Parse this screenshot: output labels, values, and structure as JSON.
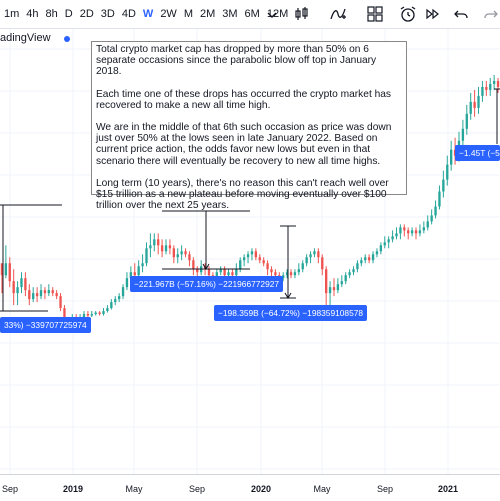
{
  "toolbar": {
    "timeframes": [
      "1m",
      "4h",
      "8h",
      "D",
      "2D",
      "3D",
      "4D",
      "W",
      "2W",
      "M",
      "2M",
      "3M",
      "6M",
      "12M"
    ],
    "active": "W",
    "icons": [
      "chevron-down-icon",
      "bar-style-icon",
      "indicators-icon",
      "layout-icon",
      "alert-icon",
      "replay-icon",
      "undo-icon",
      "redo-icon"
    ]
  },
  "watermark": "adingView",
  "note": {
    "p1": "Total crypto market cap has dropped by more than 50% on 6 separate occasions since the parabolic blow off top in January 2018.",
    "p2": "Each time one of these drops has occurred the crypto market has recovered to make a new all time high.",
    "p3": "We are in the middle of that 6th such occasion as price was down just over 50% at the lows seen in late January 2022. Based on current price action, the odds favor new lows but even in that scenario there will eventually be recovery to new all time highs.",
    "p4": "Long term (10 years), there's no reason this can't reach well over $15 trillion as a new plateau before moving eventually over $100 trillion over the next 25 years."
  },
  "measurements": {
    "m1": "33%) −339707725974",
    "m2": "−221.967B (−57.16%) −221966772927",
    "m3": "−198.359B (−64.72%) −198359108578",
    "m4": "−1.45T (−5"
  },
  "colors": {
    "up": "#26a69a",
    "down": "#ef5350",
    "accent": "#2962ff"
  },
  "chart_data": {
    "type": "candlestick",
    "x_ticks": [
      "Sep",
      "2019",
      "May",
      "Sep",
      "2020",
      "May",
      "Sep",
      "2021"
    ],
    "series_note": "Weekly total crypto market cap, values in chart price units (approximate)",
    "candles": [
      [
        0.3,
        0.26,
        0.2,
        0.29
      ],
      [
        0.26,
        0.3,
        0.25,
        0.36
      ],
      [
        0.3,
        0.24,
        0.22,
        0.32
      ],
      [
        0.24,
        0.2,
        0.16,
        0.28
      ],
      [
        0.2,
        0.22,
        0.16,
        0.24
      ],
      [
        0.22,
        0.25,
        0.2,
        0.27
      ],
      [
        0.25,
        0.21,
        0.19,
        0.27
      ],
      [
        0.21,
        0.18,
        0.16,
        0.23
      ],
      [
        0.18,
        0.2,
        0.17,
        0.22
      ],
      [
        0.2,
        0.19,
        0.17,
        0.22
      ],
      [
        0.19,
        0.21,
        0.18,
        0.23
      ],
      [
        0.21,
        0.2,
        0.18,
        0.22
      ],
      [
        0.2,
        0.21,
        0.19,
        0.23
      ],
      [
        0.21,
        0.2,
        0.19,
        0.22
      ],
      [
        0.2,
        0.19,
        0.18,
        0.21
      ],
      [
        0.19,
        0.15,
        0.14,
        0.2
      ],
      [
        0.15,
        0.11,
        0.1,
        0.16
      ],
      [
        0.11,
        0.1,
        0.09,
        0.12
      ],
      [
        0.1,
        0.12,
        0.09,
        0.13
      ],
      [
        0.12,
        0.11,
        0.1,
        0.13
      ],
      [
        0.11,
        0.12,
        0.1,
        0.13
      ],
      [
        0.12,
        0.13,
        0.11,
        0.14
      ],
      [
        0.13,
        0.125,
        0.12,
        0.14
      ],
      [
        0.125,
        0.13,
        0.12,
        0.14
      ],
      [
        0.13,
        0.135,
        0.125,
        0.14
      ],
      [
        0.135,
        0.13,
        0.125,
        0.14
      ],
      [
        0.13,
        0.14,
        0.125,
        0.15
      ],
      [
        0.14,
        0.15,
        0.135,
        0.16
      ],
      [
        0.15,
        0.17,
        0.145,
        0.18
      ],
      [
        0.17,
        0.18,
        0.16,
        0.19
      ],
      [
        0.18,
        0.19,
        0.17,
        0.2
      ],
      [
        0.19,
        0.22,
        0.18,
        0.23
      ],
      [
        0.22,
        0.25,
        0.21,
        0.27
      ],
      [
        0.25,
        0.27,
        0.24,
        0.29
      ],
      [
        0.27,
        0.26,
        0.25,
        0.3
      ],
      [
        0.26,
        0.29,
        0.25,
        0.31
      ],
      [
        0.29,
        0.3,
        0.27,
        0.33
      ],
      [
        0.3,
        0.35,
        0.29,
        0.37
      ],
      [
        0.35,
        0.36,
        0.32,
        0.4
      ],
      [
        0.36,
        0.38,
        0.34,
        0.4
      ],
      [
        0.38,
        0.36,
        0.33,
        0.4
      ],
      [
        0.36,
        0.34,
        0.32,
        0.38
      ],
      [
        0.34,
        0.36,
        0.33,
        0.38
      ],
      [
        0.36,
        0.35,
        0.33,
        0.38
      ],
      [
        0.35,
        0.32,
        0.3,
        0.36
      ],
      [
        0.32,
        0.33,
        0.3,
        0.35
      ],
      [
        0.33,
        0.34,
        0.31,
        0.36
      ],
      [
        0.34,
        0.33,
        0.32,
        0.35
      ],
      [
        0.33,
        0.31,
        0.29,
        0.34
      ],
      [
        0.31,
        0.28,
        0.26,
        0.32
      ],
      [
        0.28,
        0.27,
        0.25,
        0.29
      ],
      [
        0.27,
        0.29,
        0.26,
        0.31
      ],
      [
        0.29,
        0.28,
        0.26,
        0.3
      ],
      [
        0.28,
        0.26,
        0.24,
        0.29
      ],
      [
        0.26,
        0.25,
        0.24,
        0.27
      ],
      [
        0.25,
        0.27,
        0.24,
        0.28
      ],
      [
        0.27,
        0.28,
        0.26,
        0.29
      ],
      [
        0.28,
        0.26,
        0.25,
        0.29
      ],
      [
        0.26,
        0.27,
        0.25,
        0.28
      ],
      [
        0.27,
        0.26,
        0.25,
        0.28
      ],
      [
        0.26,
        0.28,
        0.25,
        0.3
      ],
      [
        0.28,
        0.31,
        0.27,
        0.32
      ],
      [
        0.31,
        0.32,
        0.29,
        0.33
      ],
      [
        0.32,
        0.33,
        0.3,
        0.34
      ],
      [
        0.33,
        0.34,
        0.31,
        0.35
      ],
      [
        0.34,
        0.32,
        0.31,
        0.35
      ],
      [
        0.32,
        0.31,
        0.3,
        0.33
      ],
      [
        0.31,
        0.3,
        0.29,
        0.32
      ],
      [
        0.3,
        0.28,
        0.26,
        0.31
      ],
      [
        0.28,
        0.27,
        0.25,
        0.29
      ],
      [
        0.27,
        0.26,
        0.24,
        0.28
      ],
      [
        0.26,
        0.25,
        0.24,
        0.27
      ],
      [
        0.25,
        0.26,
        0.24,
        0.27
      ],
      [
        0.26,
        0.27,
        0.25,
        0.28
      ],
      [
        0.27,
        0.26,
        0.25,
        0.28
      ],
      [
        0.26,
        0.27,
        0.25,
        0.28
      ],
      [
        0.27,
        0.28,
        0.26,
        0.3
      ],
      [
        0.28,
        0.3,
        0.27,
        0.31
      ],
      [
        0.3,
        0.32,
        0.29,
        0.33
      ],
      [
        0.32,
        0.33,
        0.3,
        0.34
      ],
      [
        0.33,
        0.34,
        0.32,
        0.35
      ],
      [
        0.34,
        0.32,
        0.3,
        0.35
      ],
      [
        0.32,
        0.28,
        0.26,
        0.33
      ],
      [
        0.28,
        0.2,
        0.12,
        0.29
      ],
      [
        0.2,
        0.22,
        0.14,
        0.24
      ],
      [
        0.22,
        0.21,
        0.19,
        0.25
      ],
      [
        0.21,
        0.23,
        0.2,
        0.25
      ],
      [
        0.23,
        0.24,
        0.22,
        0.26
      ],
      [
        0.24,
        0.26,
        0.23,
        0.27
      ],
      [
        0.26,
        0.27,
        0.25,
        0.28
      ],
      [
        0.27,
        0.28,
        0.26,
        0.29
      ],
      [
        0.28,
        0.3,
        0.27,
        0.31
      ],
      [
        0.3,
        0.31,
        0.29,
        0.32
      ],
      [
        0.31,
        0.32,
        0.3,
        0.33
      ],
      [
        0.32,
        0.31,
        0.3,
        0.33
      ],
      [
        0.31,
        0.33,
        0.3,
        0.34
      ],
      [
        0.33,
        0.34,
        0.32,
        0.35
      ],
      [
        0.34,
        0.36,
        0.33,
        0.37
      ],
      [
        0.36,
        0.37,
        0.35,
        0.39
      ],
      [
        0.37,
        0.38,
        0.35,
        0.39
      ],
      [
        0.38,
        0.39,
        0.37,
        0.41
      ],
      [
        0.39,
        0.4,
        0.38,
        0.42
      ],
      [
        0.4,
        0.42,
        0.38,
        0.43
      ],
      [
        0.42,
        0.41,
        0.39,
        0.43
      ],
      [
        0.41,
        0.4,
        0.38,
        0.42
      ],
      [
        0.4,
        0.41,
        0.39,
        0.42
      ],
      [
        0.41,
        0.4,
        0.38,
        0.42
      ],
      [
        0.4,
        0.41,
        0.39,
        0.43
      ],
      [
        0.41,
        0.42,
        0.4,
        0.44
      ],
      [
        0.42,
        0.44,
        0.41,
        0.46
      ],
      [
        0.44,
        0.46,
        0.43,
        0.48
      ],
      [
        0.46,
        0.49,
        0.45,
        0.51
      ],
      [
        0.49,
        0.54,
        0.48,
        0.56
      ],
      [
        0.54,
        0.58,
        0.52,
        0.61
      ],
      [
        0.58,
        0.63,
        0.56,
        0.66
      ],
      [
        0.63,
        0.68,
        0.61,
        0.71
      ],
      [
        0.68,
        0.66,
        0.63,
        0.72
      ],
      [
        0.66,
        0.71,
        0.64,
        0.74
      ],
      [
        0.71,
        0.75,
        0.69,
        0.78
      ],
      [
        0.75,
        0.8,
        0.73,
        0.83
      ],
      [
        0.8,
        0.84,
        0.78,
        0.87
      ],
      [
        0.84,
        0.82,
        0.79,
        0.88
      ],
      [
        0.82,
        0.86,
        0.8,
        0.89
      ],
      [
        0.86,
        0.89,
        0.84,
        0.91
      ],
      [
        0.89,
        0.88,
        0.86,
        0.91
      ],
      [
        0.88,
        0.9,
        0.86,
        0.92
      ],
      [
        0.9,
        0.91,
        0.88,
        0.93
      ],
      [
        0.91,
        0.89,
        0.87,
        0.92
      ]
    ]
  }
}
